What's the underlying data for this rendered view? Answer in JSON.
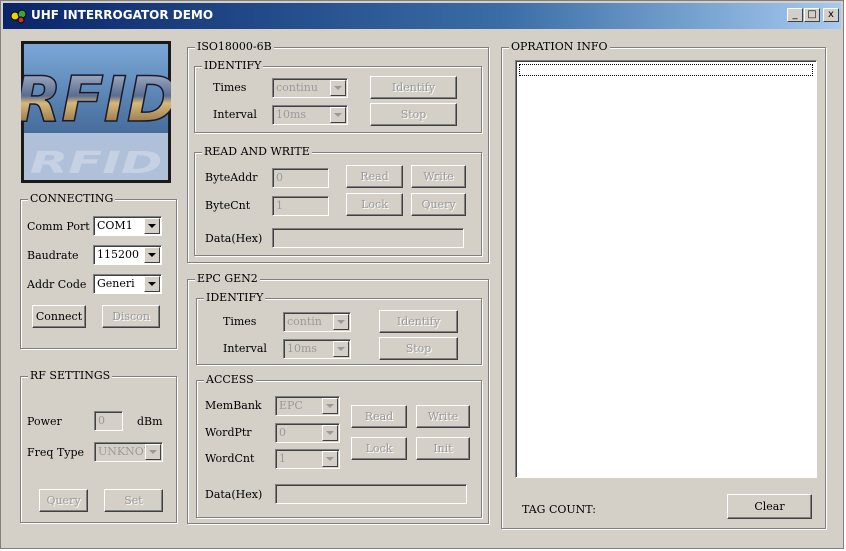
{
  "window": {
    "title": "UHF INTERROGATOR DEMO",
    "controls": [
      "_",
      "□",
      "x"
    ]
  },
  "logo": {
    "text": "RFID"
  },
  "connecting": {
    "label": "CONNECTING",
    "comm_port_label": "Comm Port",
    "comm_port_value": "COM1",
    "baudrate_label": "Baudrate",
    "baudrate_value": "115200",
    "addr_code_label": "Addr Code",
    "addr_code_value": "Generi",
    "connect_label": "Connect",
    "discon_label": "Discon"
  },
  "rf_settings": {
    "label": "RF SETTINGS",
    "power_label": "Power",
    "power_value": "0",
    "power_unit": "dBm",
    "freq_type_label": "Freq Type",
    "freq_type_value": "UNKNOW",
    "query_label": "Query",
    "set_label": "Set"
  },
  "iso": {
    "label": "ISO18000-6B",
    "identify": {
      "label": "IDENTIFY",
      "times_label": "Times",
      "times_value": "continu",
      "interval_label": "Interval",
      "interval_value": "10ms",
      "identify_label": "Identify",
      "stop_label": "Stop"
    },
    "rw": {
      "label": "READ AND WRITE",
      "byteaddr_label": "ByteAddr",
      "byteaddr_value": "0",
      "bytecnt_label": "ByteCnt",
      "bytecnt_value": "1",
      "data_label": "Data(Hex)",
      "data_value": "",
      "read_label": "Read",
      "write_label": "Write",
      "lock_label": "Lock",
      "query_label": "Query"
    }
  },
  "epc": {
    "label": "EPC GEN2",
    "identify": {
      "label": "IDENTIFY",
      "times_label": "Times",
      "times_value": "contin",
      "interval_label": "Interval",
      "interval_value": "10ms",
      "identify_label": "Identify",
      "stop_label": "Stop"
    },
    "access": {
      "label": "ACCESS",
      "membank_label": "MemBank",
      "membank_value": "EPC",
      "wordptr_label": "WordPtr",
      "wordptr_value": "0",
      "wordcnt_label": "WordCnt",
      "wordcnt_value": "1",
      "data_label": "Data(Hex)",
      "data_value": "",
      "read_label": "Read",
      "write_label": "Write",
      "lock_label": "Lock",
      "init_label": "Init"
    }
  },
  "info": {
    "label": "OPRATION INFO",
    "tag_count_label": "TAG COUNT:",
    "clear_label": "Clear"
  },
  "colors": {
    "face": "#d4d0c8",
    "title_start": "#0a246a",
    "title_end": "#a6caf0",
    "disabled_text": "#9a9a9a"
  }
}
